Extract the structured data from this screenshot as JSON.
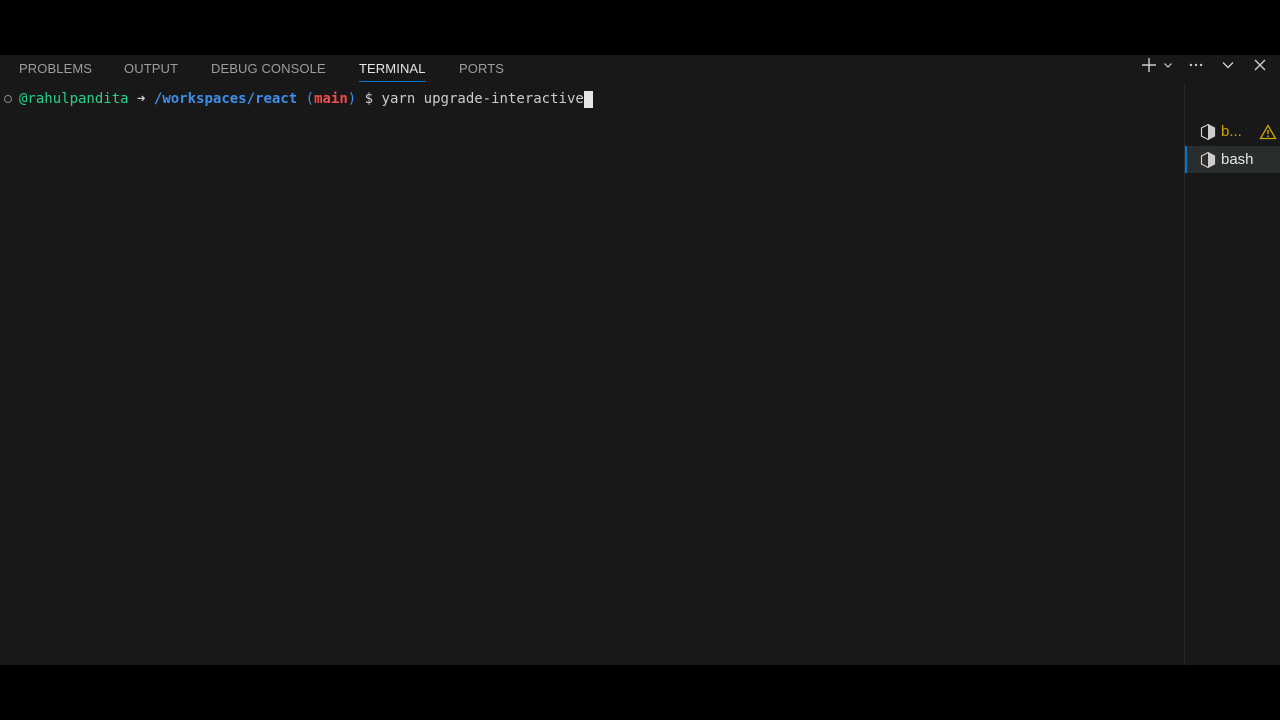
{
  "panel": {
    "tabs": [
      {
        "label": "PROBLEMS"
      },
      {
        "label": "OUTPUT"
      },
      {
        "label": "DEBUG CONSOLE"
      },
      {
        "label": "TERMINAL"
      },
      {
        "label": "PORTS"
      }
    ],
    "active_tab": "TERMINAL",
    "actions": [
      {
        "icon": "plus-icon"
      },
      {
        "icon": "chevron-down-icon"
      },
      {
        "icon": "more-icon"
      },
      {
        "icon": "chevron-down-icon"
      },
      {
        "icon": "close-icon"
      }
    ]
  },
  "terminal": {
    "prompt": {
      "user": "@rahulpandita",
      "arrow": "➜",
      "path": "/workspaces/react",
      "paren_open": "(",
      "branch": "main",
      "paren_close": ")",
      "dollar": "$",
      "command": "yarn upgrade-interactive"
    }
  },
  "terminal_list": [
    {
      "label": "b...",
      "icon": "terminal-bash-icon",
      "warning": true,
      "label_color": "#cca700"
    },
    {
      "label": "bash",
      "icon": "terminal-bash-icon",
      "warning": false,
      "active": true
    }
  ],
  "colors": {
    "panel_bg": "#181818",
    "accent": "#0078d4",
    "user": "#23d18b",
    "path": "#3b8eea",
    "branch": "#f14c4c",
    "warning": "#cca700"
  }
}
